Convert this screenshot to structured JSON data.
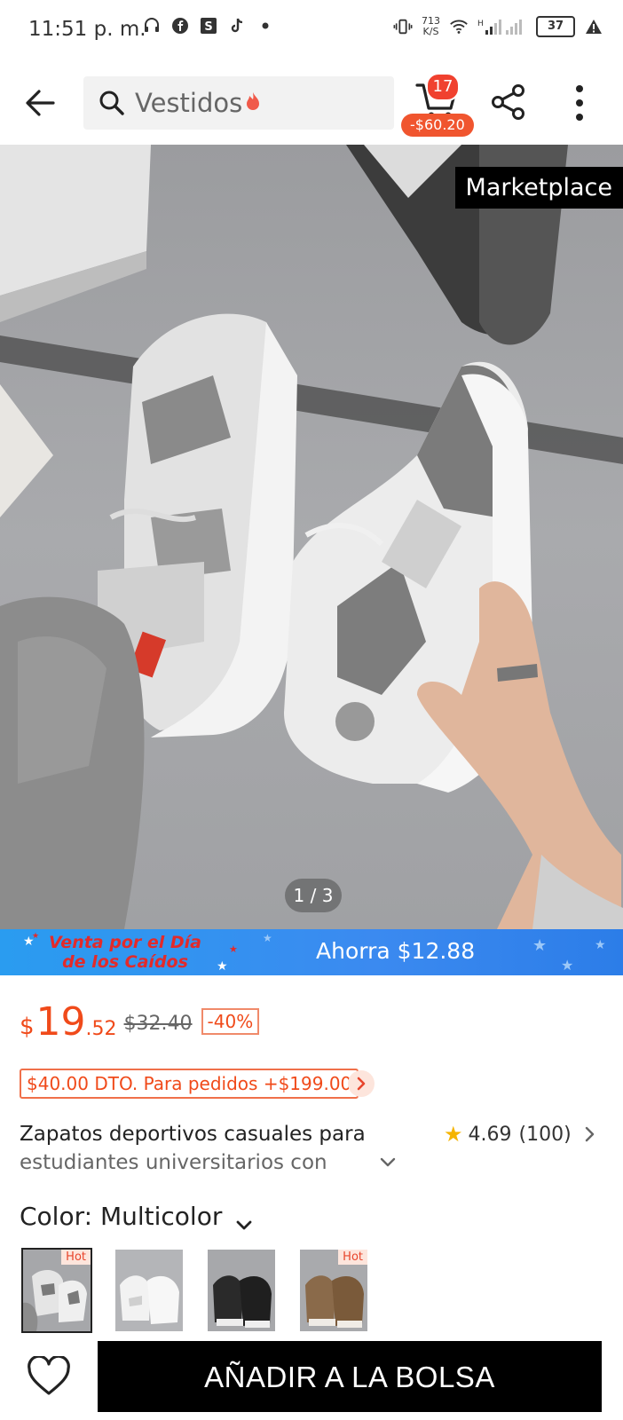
{
  "status_bar": {
    "time": "11:51 p. m.",
    "net_speed": "713\nK/S",
    "battery": "37",
    "icons": [
      "headphones-icon",
      "facebook-icon",
      "s-app-icon",
      "tiktok-icon",
      "dot-icon",
      "vibrate-icon",
      "wifi-icon",
      "signal-icon",
      "battery-icon",
      "alert-icon"
    ]
  },
  "header": {
    "search_placeholder": "Vestidos",
    "cart_count": "17",
    "cart_price": "-$60.20",
    "icons": [
      "back-arrow-icon",
      "search-icon",
      "fire-icon",
      "cart-icon",
      "share-icon",
      "more-icon"
    ]
  },
  "hero": {
    "marketplace_label": "Marketplace",
    "pager": "1 / 3",
    "image_description_colors": {
      "floor": "#a7a8ab",
      "sneaker_upper": "#e8e8e8",
      "sneaker_suede": "#7d7d7d",
      "sole": "#f2f2f2"
    }
  },
  "banner": {
    "title": "Venta por el Día de los Caídos",
    "savings": "Ahorra $12.88"
  },
  "price": {
    "currency": "$",
    "integer": "19",
    "decimals": ".52",
    "original": "$32.40",
    "discount": "-40%"
  },
  "coupon": "$40.00 DTO. Para pedidos +$199.00",
  "product": {
    "title_line1": "Zapatos deportivos casuales para",
    "title_line2": "estudiantes universitarios con",
    "rating": "4.69",
    "reviews": "(100)"
  },
  "color_selector": {
    "label": "Color: Multicolor",
    "swatches": [
      {
        "name": "gray-white",
        "hot": "Hot",
        "selected": true
      },
      {
        "name": "white",
        "hot": "",
        "selected": false
      },
      {
        "name": "black",
        "hot": "",
        "selected": false
      },
      {
        "name": "brown",
        "hot": "Hot",
        "selected": false
      }
    ]
  },
  "bottom_bar": {
    "add_to_bag": "AÑADIR A LA BOLSA"
  },
  "colors": {
    "accent": "#f04a1a",
    "banner_blue": "#3b8af0",
    "cta": "#000000"
  }
}
